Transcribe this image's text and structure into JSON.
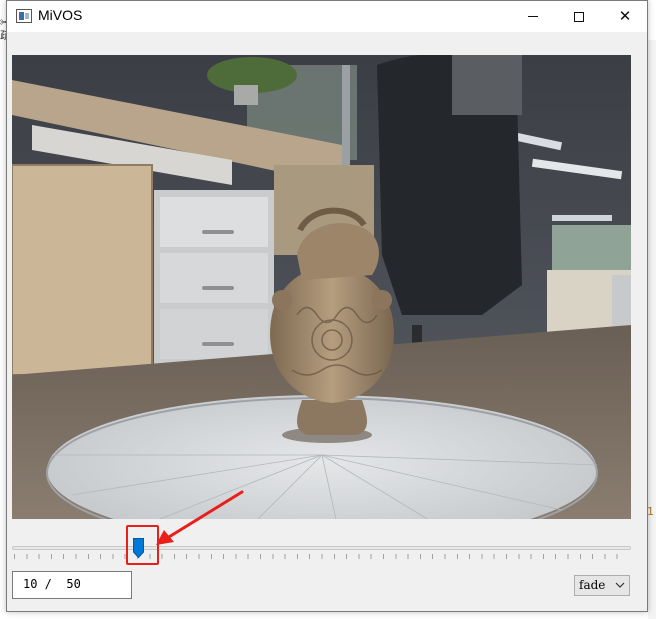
{
  "window": {
    "title": "MiVOS",
    "icon": "app-window-icon",
    "controls": [
      "minimize-icon",
      "maximize-icon",
      "close-icon"
    ]
  },
  "video": {
    "content": "rendered frame: carved ceramic vase on a turntable in an office"
  },
  "timeline": {
    "current_frame": 10,
    "total_frames": 50,
    "position_fraction": 0.2,
    "frame_label": "10 /  50"
  },
  "blend_mode": {
    "selected": "fade"
  },
  "annotation": {
    "highlight_color": "#e8201b"
  },
  "background": {
    "right_char": "1"
  }
}
